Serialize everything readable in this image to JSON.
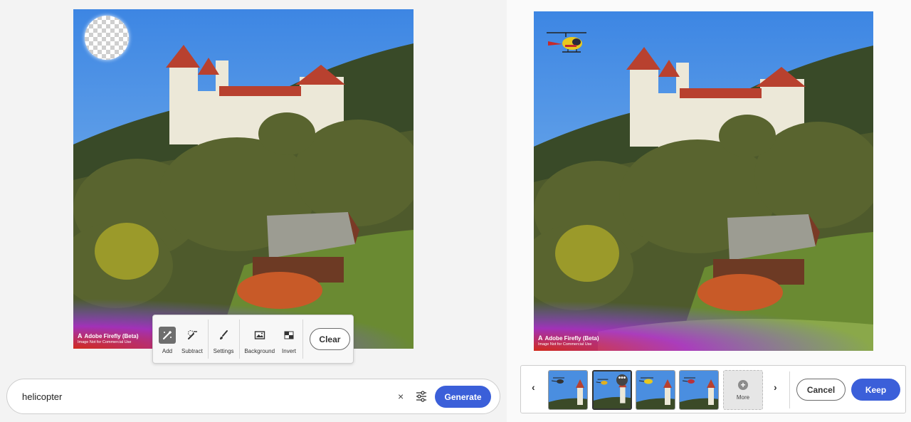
{
  "left": {
    "tools": [
      {
        "label": "Add",
        "icon": "add-brush-icon",
        "active": true
      },
      {
        "label": "Subtract",
        "icon": "subtract-brush-icon",
        "active": false
      },
      {
        "label": "Settings",
        "icon": "brush-settings-icon",
        "active": false
      },
      {
        "label": "Background",
        "icon": "image-background-icon",
        "active": false
      },
      {
        "label": "Invert",
        "icon": "invert-icon",
        "active": false
      }
    ],
    "clear_label": "Clear",
    "prompt_value": "helicopter",
    "clear_prompt_glyph": "×",
    "generate_label": "Generate"
  },
  "watermark": {
    "logo": "A",
    "title": "Adobe Firefly (Beta)",
    "subtitle": "Image Not for Commercial Use"
  },
  "right": {
    "prev_glyph": "‹",
    "next_glyph": "›",
    "thumbnails": [
      {
        "selected": false,
        "helicopter_color": "#333333"
      },
      {
        "selected": true,
        "helicopter_color": "#e0b020",
        "more_glyph": "•••"
      },
      {
        "selected": false,
        "helicopter_color": "#e8c81e"
      },
      {
        "selected": false,
        "helicopter_color": "#b8323c"
      }
    ],
    "more_plus": "+",
    "more_label": "More",
    "cancel_label": "Cancel",
    "keep_label": "Keep"
  },
  "colors": {
    "accent": "#3b5fd9",
    "sky": "#4a8ee0",
    "roof_red": "#b8412f"
  }
}
